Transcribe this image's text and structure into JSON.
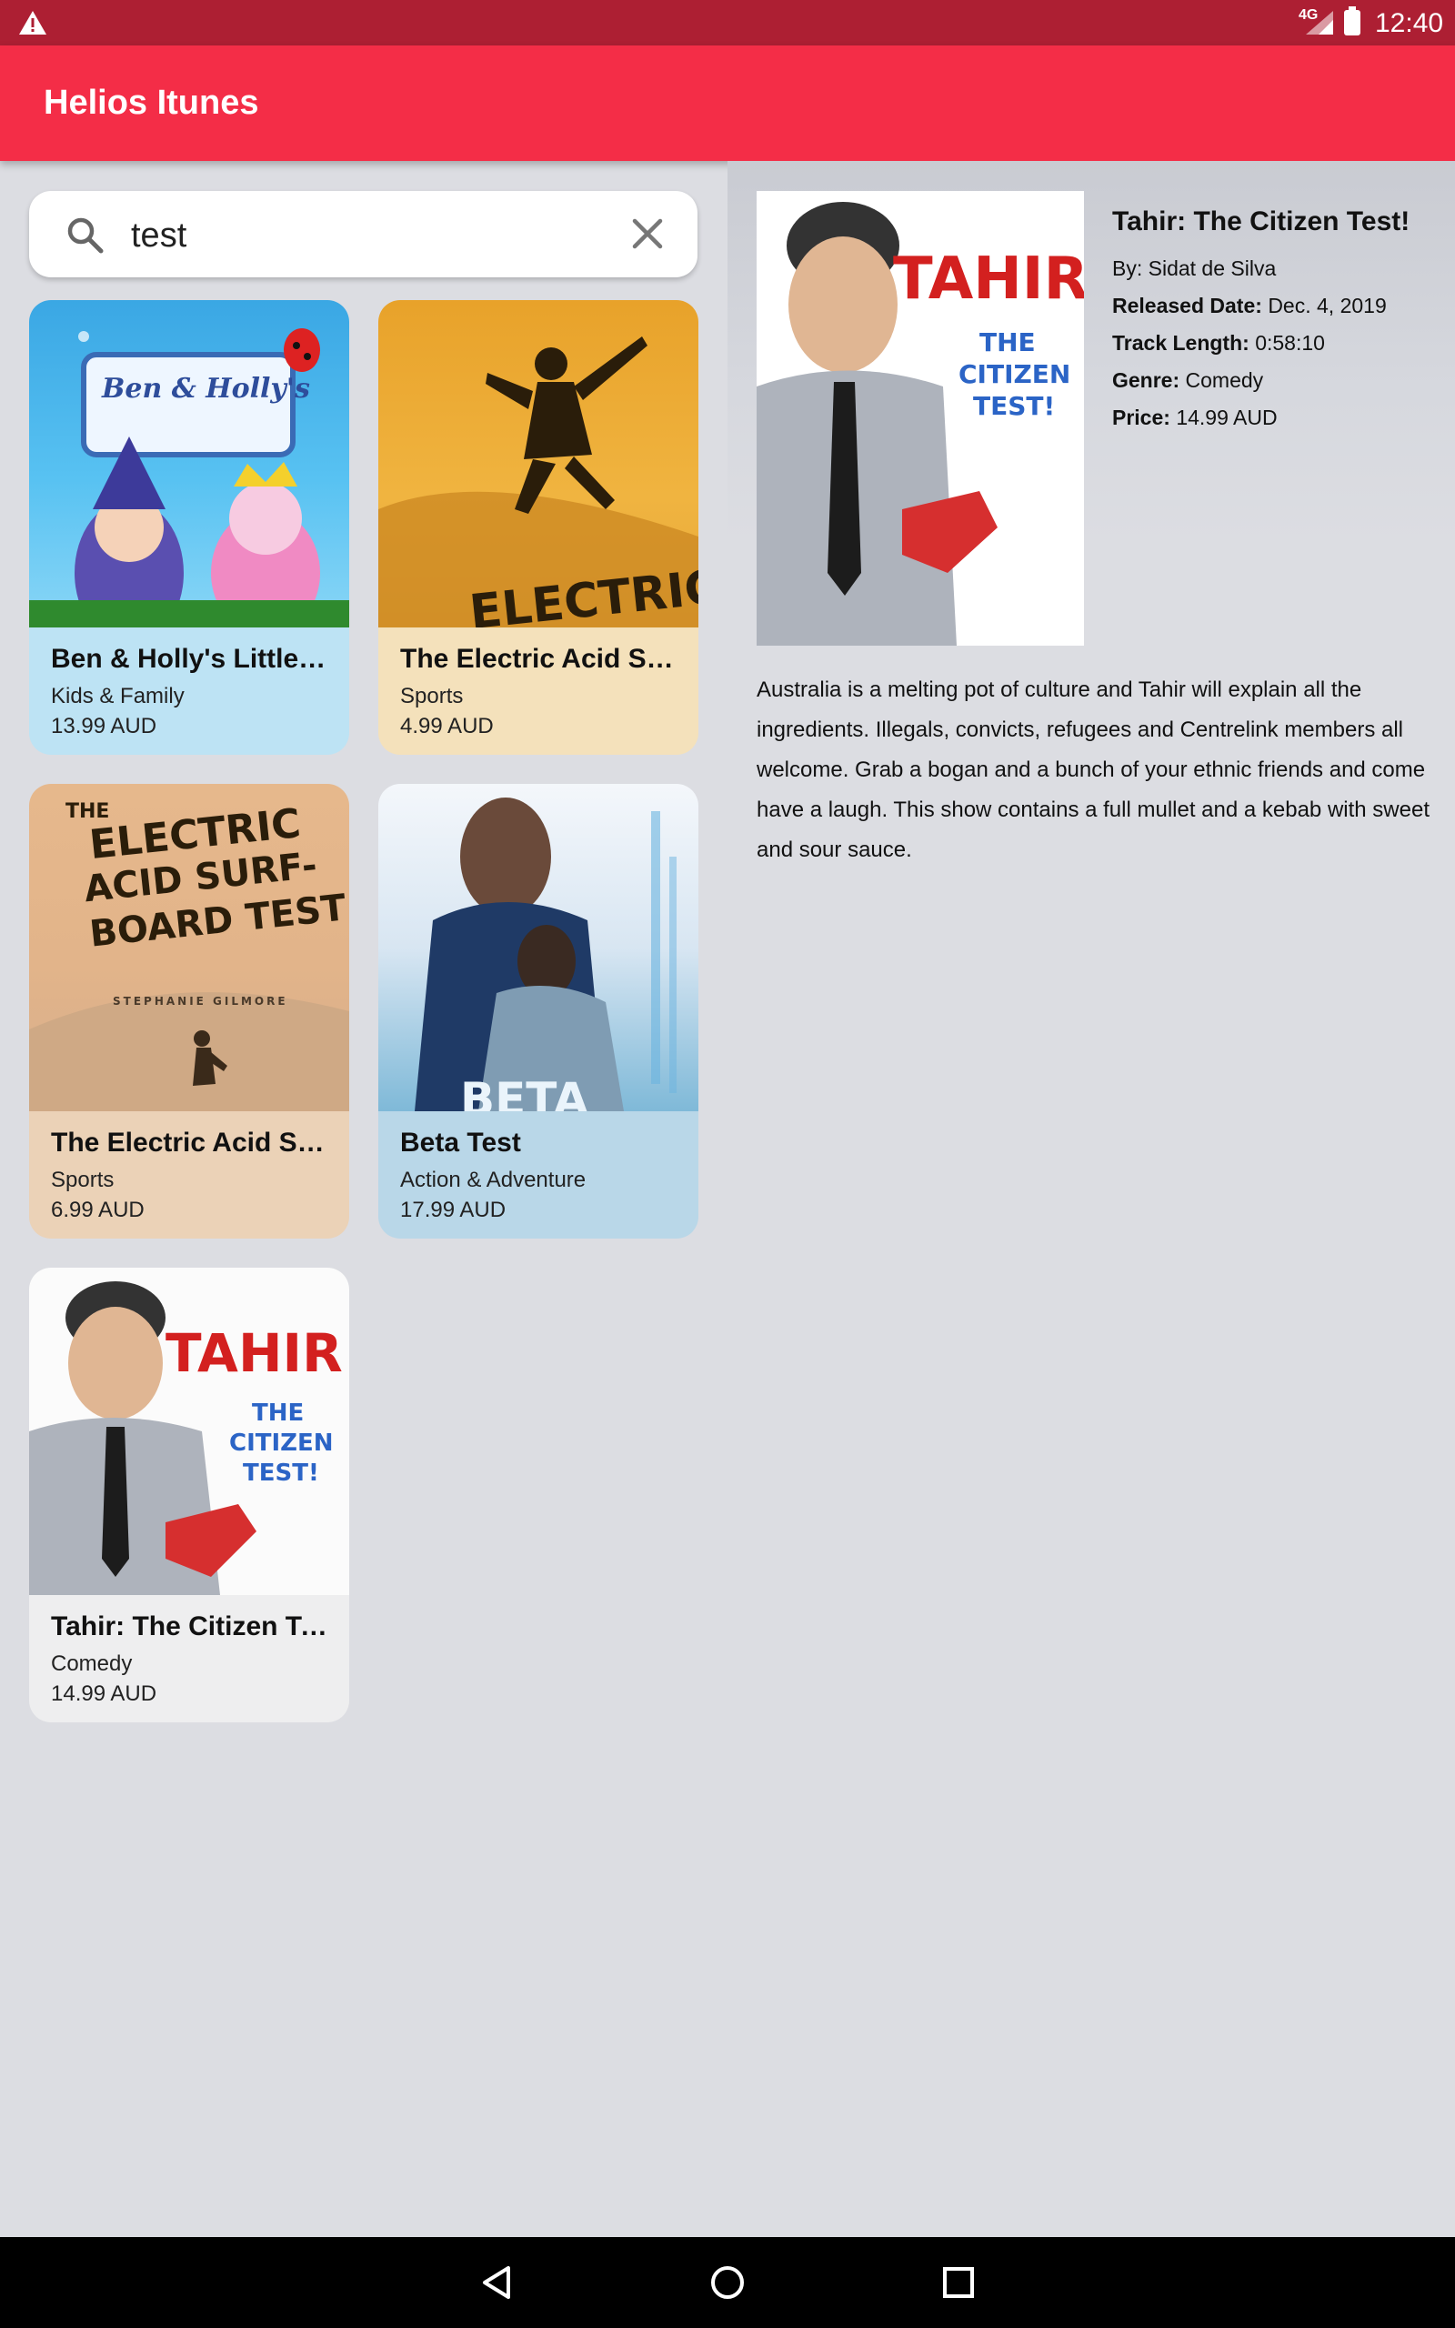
{
  "status_bar": {
    "network": "4G",
    "time": "12:40",
    "icons": [
      "warning-icon",
      "signal-icon",
      "battery-icon"
    ]
  },
  "app_bar": {
    "title": "Helios Itunes"
  },
  "search": {
    "value": "test"
  },
  "results": [
    {
      "title": "Ben & Holly's Little K...",
      "genre": "Kids & Family",
      "price": "13.99 AUD"
    },
    {
      "title": "The Electric Acid Sur...",
      "genre": "Sports",
      "price": "4.99 AUD"
    },
    {
      "title": "The Electric Acid Sur...",
      "genre": "Sports",
      "price": "6.99 AUD"
    },
    {
      "title": "Beta Test",
      "genre": "Action & Adventure",
      "price": "17.99 AUD"
    },
    {
      "title": "Tahir: The Citizen Te...",
      "genre": "Comedy",
      "price": "14.99 AUD"
    }
  ],
  "detail": {
    "title": "Tahir: The Citizen Test!",
    "by": "By: Sidat de Silva",
    "released_label": "Released Date:",
    "released": "Dec. 4, 2019",
    "length_label": "Track Length:",
    "length": "0:58:10",
    "genre_label": "Genre:",
    "genre": "Comedy",
    "price_label": "Price:",
    "price": "14.99 AUD",
    "description": "Australia is a melting pot of culture and Tahir will explain all the ingredients. Illegals, convicts, refugees and Centrelink members all welcome. Grab a bogan and a bunch of your ethnic friends and come have a laugh. This show contains a full mullet and a kebab with sweet and sour sauce."
  },
  "artwork_text": {
    "benholly": "Ben & Holly's",
    "electric": "ELECTRIC",
    "electric_full_1": "THE",
    "electric_full_2": "ELECTRIC",
    "electric_full_3": "ACID SURF-",
    "electric_full_4": "BOARD TEST",
    "electric_author": "STEPHANIE GILMORE",
    "beta": "BETA",
    "tahir": "TAHIR",
    "tahir_sub1": "THE",
    "tahir_sub2": "CITIZEN",
    "tahir_sub3": "TEST!"
  },
  "nav_bar": {
    "buttons": [
      "back-icon",
      "home-icon",
      "recents-icon"
    ]
  }
}
